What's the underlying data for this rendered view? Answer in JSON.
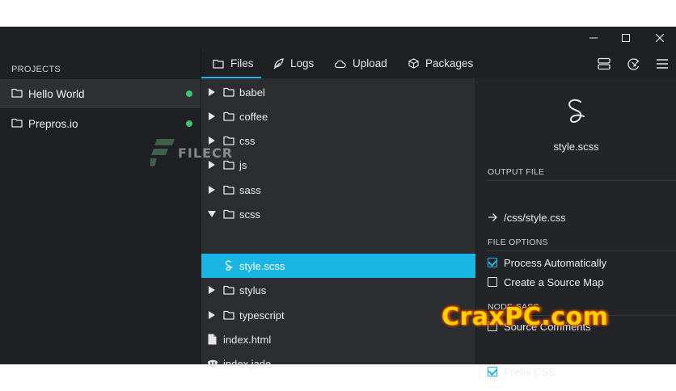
{
  "window": {
    "controls": [
      "minimize",
      "maximize",
      "close"
    ]
  },
  "sidebar": {
    "title": "PROJECTS",
    "projects": [
      {
        "name": "Hello World",
        "status_color": "#3ec46d",
        "selected": true
      },
      {
        "name": "Prepros.io",
        "status_color": "#3ec46d",
        "selected": false
      }
    ]
  },
  "toolbar": {
    "tabs": [
      {
        "label": "Files",
        "icon": "folder-icon",
        "active": true
      },
      {
        "label": "Logs",
        "icon": "feather-icon",
        "active": false
      },
      {
        "label": "Upload",
        "icon": "cloud-icon",
        "active": false
      },
      {
        "label": "Packages",
        "icon": "box-icon",
        "active": false
      }
    ],
    "right_icons": [
      "server-icon",
      "browser-sync-icon",
      "menu-icon"
    ]
  },
  "files": {
    "items": [
      {
        "name": "babel",
        "type": "folder",
        "expanded": false
      },
      {
        "name": "coffee",
        "type": "folder",
        "expanded": false
      },
      {
        "name": "css",
        "type": "folder",
        "expanded": false
      },
      {
        "name": "js",
        "type": "folder",
        "expanded": false
      },
      {
        "name": "sass",
        "type": "folder",
        "expanded": false
      },
      {
        "name": "scss",
        "type": "folder",
        "expanded": true
      },
      {
        "name": "style.scss",
        "type": "sass-file",
        "selected": true
      },
      {
        "name": "stylus",
        "type": "folder",
        "expanded": false
      },
      {
        "name": "typescript",
        "type": "folder",
        "expanded": false
      },
      {
        "name": "index.html",
        "type": "html-file"
      },
      {
        "name": "index.jade",
        "type": "jade-file"
      }
    ]
  },
  "detail": {
    "file_name": "style.scss",
    "file_icon": "sass-icon",
    "output_file_heading": "OUTPUT FILE",
    "output_path": "/css/style.css",
    "file_options_heading": "FILE OPTIONS",
    "process_automatically": {
      "label": "Process Automatically",
      "checked": true
    },
    "source_map": {
      "label": "Create a Source Map",
      "checked": false
    },
    "node_sass_heading": "NODE-SASS",
    "source_comments": {
      "label": "Source Comments",
      "checked": false
    },
    "prefix_css": {
      "label": "Prefix CSS",
      "checked": true
    }
  },
  "watermarks": {
    "filecr": "FILECR",
    "craxpc": "CraxPC.com"
  },
  "colors": {
    "accent": "#19b5e5",
    "status_green": "#3ec46d",
    "background": "#2b2d30",
    "panel": "#1f2023"
  }
}
